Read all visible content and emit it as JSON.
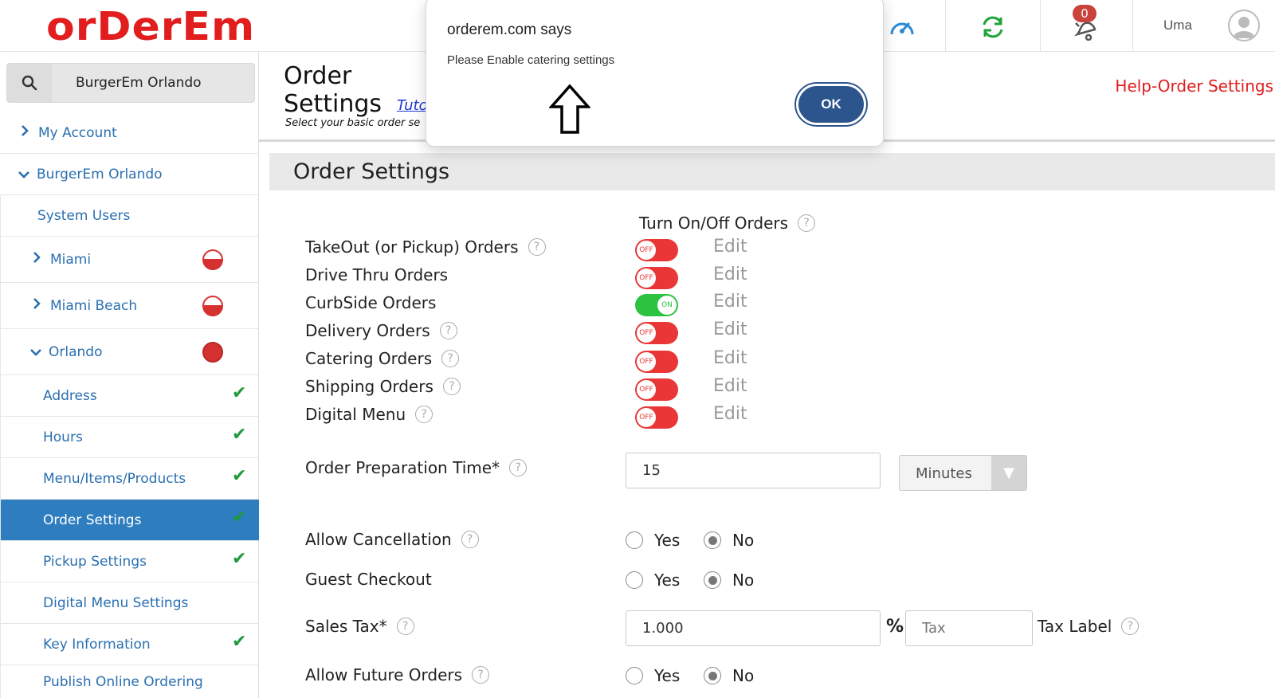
{
  "header": {
    "logo_text": "orDerEm",
    "notification_count": "0",
    "user_name": "Uma",
    "icons": [
      "dashboard-icon",
      "refresh-icon",
      "bell-icon",
      "avatar-icon"
    ]
  },
  "sidebar": {
    "search_value": "BurgerEm Orlando",
    "items": [
      {
        "label": "My Account"
      },
      {
        "label": "BurgerEm Orlando"
      },
      {
        "label": "System Users"
      },
      {
        "label": "Miami"
      },
      {
        "label": "Miami Beach"
      },
      {
        "label": "Orlando"
      },
      {
        "label": "Address"
      },
      {
        "label": "Hours"
      },
      {
        "label": "Menu/Items/Products"
      },
      {
        "label": "Order Settings"
      },
      {
        "label": "Pickup Settings"
      },
      {
        "label": "Digital Menu Settings"
      },
      {
        "label": "Key Information"
      },
      {
        "label": "Publish Online Ordering"
      }
    ]
  },
  "page": {
    "title_line1": "Order",
    "title_line2": "Settings",
    "tutorial_link": "Tuto",
    "subtitle": "Select your basic order se",
    "help_link": "Help-Order Settings",
    "panel_title": "Order Settings",
    "turn_onoff_label": "Turn On/Off Orders",
    "edit_label": "Edit",
    "order_types": [
      {
        "label": "TakeOut (or Pickup) Orders",
        "state": "OFF"
      },
      {
        "label": "Drive Thru Orders",
        "state": "OFF"
      },
      {
        "label": "CurbSide Orders",
        "state": "ON"
      },
      {
        "label": "Delivery Orders",
        "state": "OFF"
      },
      {
        "label": "Catering Orders",
        "state": "OFF"
      },
      {
        "label": "Shipping Orders",
        "state": "OFF"
      },
      {
        "label": "Digital Menu",
        "state": "OFF"
      }
    ],
    "prep_time_label": "Order Preparation Time*",
    "prep_time_value": "15",
    "prep_time_unit": "Minutes",
    "allow_cancellation_label": "Allow Cancellation",
    "guest_checkout_label": "Guest Checkout",
    "sales_tax_label": "Sales Tax*",
    "sales_tax_value": "1.000",
    "percent_symbol": "%",
    "tax_label_placeholder": "Tax",
    "tax_label_caption": "Tax Label",
    "allow_future_label": "Allow Future Orders",
    "yes": "Yes",
    "no": "No"
  },
  "dialog": {
    "title": "orderem.com says",
    "message": "Please Enable catering settings",
    "ok": "OK"
  },
  "colors": {
    "brand_red": "#e11d1d",
    "nav_blue": "#2a6fb0",
    "active_bg": "#2e7dbf",
    "toggle_off": "#ea3636",
    "toggle_on": "#2bc33f",
    "ok_button": "#2c548d"
  }
}
